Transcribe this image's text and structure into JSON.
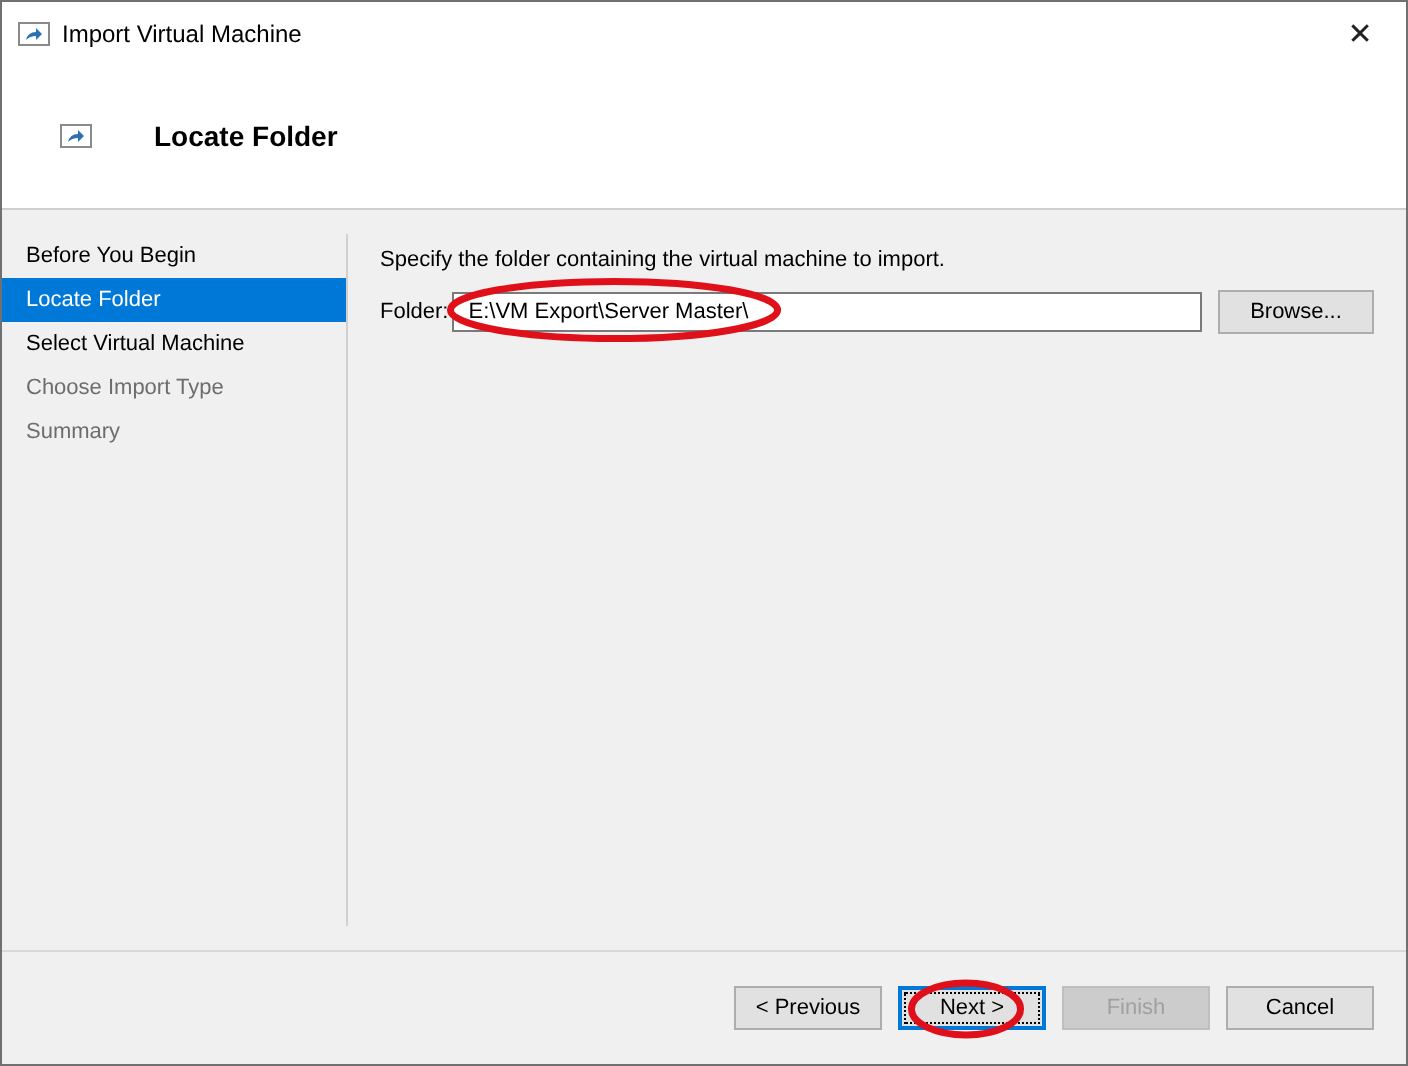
{
  "window": {
    "title": "Import Virtual Machine",
    "close": "✕"
  },
  "header": {
    "title": "Locate Folder"
  },
  "sidebar": {
    "items": [
      {
        "label": "Before You Begin",
        "selected": false,
        "disabled": false
      },
      {
        "label": "Locate Folder",
        "selected": true,
        "disabled": false
      },
      {
        "label": "Select Virtual Machine",
        "selected": false,
        "disabled": false
      },
      {
        "label": "Choose Import Type",
        "selected": false,
        "disabled": true
      },
      {
        "label": "Summary",
        "selected": false,
        "disabled": true
      }
    ]
  },
  "content": {
    "instruction": "Specify the folder containing the virtual machine to import.",
    "folder_label": "Folder:",
    "folder_value": "E:\\VM Export\\Server Master\\",
    "browse": "Browse...",
    "folder_circled": true
  },
  "buttons": [
    {
      "label": "< Previous",
      "disabled": false,
      "focused": false,
      "circled": false
    },
    {
      "label": "Next >",
      "disabled": false,
      "focused": true,
      "circled": true
    },
    {
      "label": "Finish",
      "disabled": true,
      "focused": false,
      "circled": false
    },
    {
      "label": "Cancel",
      "disabled": false,
      "focused": false,
      "circled": false
    }
  ]
}
